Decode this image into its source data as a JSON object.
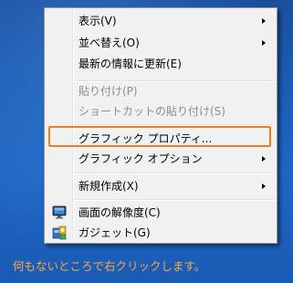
{
  "menu": {
    "items": [
      {
        "label": "表示(V)",
        "submenu": true,
        "disabled": false
      },
      {
        "label": "並べ替え(O)",
        "submenu": true,
        "disabled": false
      },
      {
        "label": "最新の情報に更新(E)",
        "submenu": false,
        "disabled": false
      },
      {
        "label": "貼り付け(P)",
        "submenu": false,
        "disabled": true
      },
      {
        "label": "ショートカットの貼り付け(S)",
        "submenu": false,
        "disabled": true
      },
      {
        "label": "グラフィック プロパティ...",
        "submenu": false,
        "disabled": false
      },
      {
        "label": "グラフィック オプション",
        "submenu": true,
        "disabled": false
      },
      {
        "label": "新規作成(X)",
        "submenu": true,
        "disabled": false
      },
      {
        "label": "画面の解像度(C)",
        "submenu": false,
        "disabled": false,
        "icon": "monitor-icon"
      },
      {
        "label": "ガジェット(G)",
        "submenu": false,
        "disabled": false,
        "icon": "gadget-icon"
      }
    ]
  },
  "caption": "何もないところで右クリックします。",
  "colors": {
    "highlight_border": "#f07c1c",
    "caption": "#ffa640",
    "desktop": "#1c5cb4"
  }
}
